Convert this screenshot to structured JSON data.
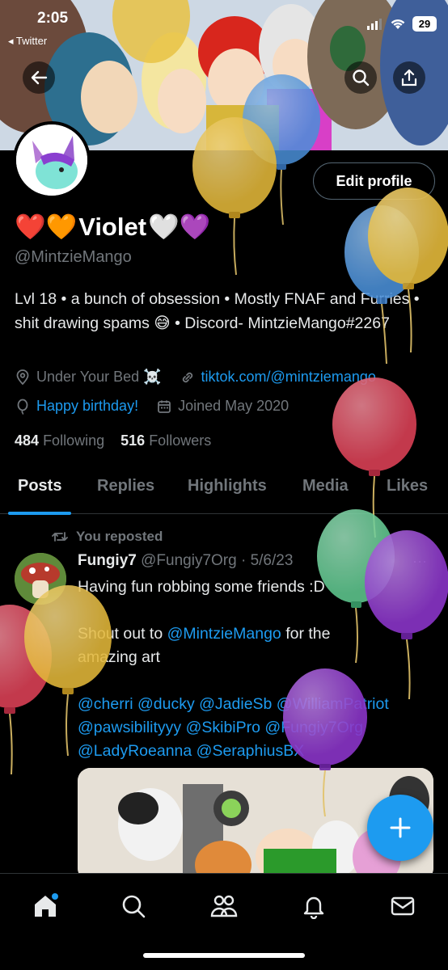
{
  "status_bar": {
    "time": "2:05",
    "back_app": "◂ Twitter",
    "battery": "29"
  },
  "profile": {
    "edit_label": "Edit profile",
    "name_emoji_left": "❤️🧡",
    "name": "Violet",
    "name_emoji_right": "🤍💜",
    "handle": "@MintzieMango",
    "bio": "Lvl 18 • a bunch of obsession • Mostly FNAF and Furries • shit drawing spams 😅 • Discord- MintzieMango#2267",
    "location": "Under Your Bed ☠️",
    "website": "tiktok.com/@mintziemango",
    "birthday": "Happy birthday!",
    "joined": "Joined May 2020",
    "following_count": "484",
    "following_label": "Following",
    "followers_count": "516",
    "followers_label": "Followers"
  },
  "tabs": [
    {
      "label": "Posts"
    },
    {
      "label": "Replies"
    },
    {
      "label": "Highlights"
    },
    {
      "label": "Media"
    },
    {
      "label": "Likes"
    }
  ],
  "post": {
    "repost_label": "You reposted",
    "author_name": "Fungiy7",
    "author_handle": "@Fungiy7Org",
    "date": "· 5/6/23",
    "more": "···",
    "line1": "Having fun robbing some friends :D",
    "line2_pre": "Shout out to ",
    "line2_mention": "@MintzieMango",
    "line2_post": " for the",
    "line3": "amazing art",
    "mentions_1": "@cherri @ducky @JadieSb @WilliamPatriot",
    "mentions_2": "@pawsibilityyy @SkibiPro @Fungiy7Org",
    "mentions_3": "@LadyRoeanna @SeraphiusBX"
  },
  "colors": {
    "accent": "#1d9bf0",
    "background": "#000000",
    "muted": "#71767b"
  },
  "icons": [
    "back-icon",
    "search-icon",
    "share-icon",
    "location-icon",
    "link-icon",
    "balloon-icon",
    "calendar-icon",
    "repost-icon",
    "compose-plus-icon",
    "home-icon",
    "explore-icon",
    "communities-icon",
    "notifications-icon",
    "messages-icon"
  ]
}
